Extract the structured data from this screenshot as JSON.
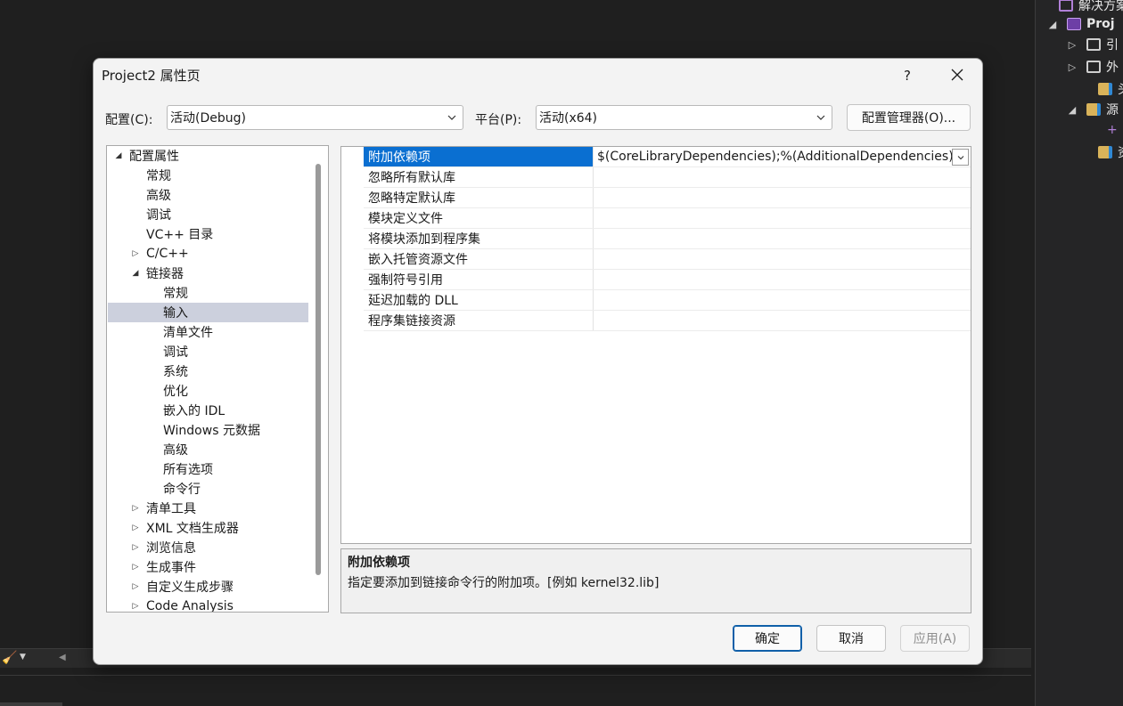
{
  "dialog": {
    "title": "Project2 属性页",
    "help_label": "?",
    "config_label": "配置(C):",
    "config_value": "活动(Debug)",
    "platform_label": "平台(P):",
    "platform_value": "活动(x64)",
    "config_manager_label": "配置管理器(O)...",
    "ok_label": "确定",
    "cancel_label": "取消",
    "apply_label": "应用(A)"
  },
  "tree": {
    "items": [
      {
        "label": "配置属性",
        "level": 0,
        "state": "expanded"
      },
      {
        "label": "常规",
        "level": 1,
        "state": "leaf"
      },
      {
        "label": "高级",
        "level": 1,
        "state": "leaf"
      },
      {
        "label": "调试",
        "level": 1,
        "state": "leaf"
      },
      {
        "label": "VC++ 目录",
        "level": 1,
        "state": "leaf"
      },
      {
        "label": "C/C++",
        "level": 1,
        "state": "collapsed"
      },
      {
        "label": "链接器",
        "level": 1,
        "state": "expanded"
      },
      {
        "label": "常规",
        "level": 2,
        "state": "leaf"
      },
      {
        "label": "输入",
        "level": 2,
        "state": "leaf",
        "selected": true
      },
      {
        "label": "清单文件",
        "level": 2,
        "state": "leaf"
      },
      {
        "label": "调试",
        "level": 2,
        "state": "leaf"
      },
      {
        "label": "系统",
        "level": 2,
        "state": "leaf"
      },
      {
        "label": "优化",
        "level": 2,
        "state": "leaf"
      },
      {
        "label": "嵌入的 IDL",
        "level": 2,
        "state": "leaf"
      },
      {
        "label": "Windows 元数据",
        "level": 2,
        "state": "leaf"
      },
      {
        "label": "高级",
        "level": 2,
        "state": "leaf"
      },
      {
        "label": "所有选项",
        "level": 2,
        "state": "leaf"
      },
      {
        "label": "命令行",
        "level": 2,
        "state": "leaf"
      },
      {
        "label": "清单工具",
        "level": 1,
        "state": "collapsed"
      },
      {
        "label": "XML 文档生成器",
        "level": 1,
        "state": "collapsed"
      },
      {
        "label": "浏览信息",
        "level": 1,
        "state": "collapsed"
      },
      {
        "label": "生成事件",
        "level": 1,
        "state": "collapsed"
      },
      {
        "label": "自定义生成步骤",
        "level": 1,
        "state": "collapsed"
      },
      {
        "label": "Code Analysis",
        "level": 1,
        "state": "collapsed"
      }
    ]
  },
  "grid": {
    "rows": [
      {
        "name": "附加依赖项",
        "value": "$(CoreLibraryDependencies);%(AdditionalDependencies)",
        "selected": true
      },
      {
        "name": "忽略所有默认库",
        "value": ""
      },
      {
        "name": "忽略特定默认库",
        "value": ""
      },
      {
        "name": "模块定义文件",
        "value": ""
      },
      {
        "name": "将模块添加到程序集",
        "value": ""
      },
      {
        "name": "嵌入托管资源文件",
        "value": ""
      },
      {
        "name": "强制符号引用",
        "value": ""
      },
      {
        "name": "延迟加载的 DLL",
        "value": ""
      },
      {
        "name": "程序集链接资源",
        "value": ""
      }
    ]
  },
  "description": {
    "title": "附加依赖项",
    "text": "指定要添加到链接命令行的附加项。[例如 kernel32.lib]"
  },
  "solution_explorer": {
    "items": [
      {
        "label": "解决方案",
        "arrow": "",
        "icon": "solution-icon"
      },
      {
        "label": "Proj",
        "arrow": "◢",
        "icon": "project-icon",
        "bold": true
      },
      {
        "label": "引",
        "arrow": "▷",
        "icon": "references-icon"
      },
      {
        "label": "外",
        "arrow": "▷",
        "icon": "external-deps-icon"
      },
      {
        "label": "头",
        "arrow": "",
        "icon": "folder-filter-icon"
      },
      {
        "label": "源",
        "arrow": "◢",
        "icon": "folder-filter-icon"
      },
      {
        "label": "+",
        "arrow": "",
        "icon": ""
      },
      {
        "label": "资",
        "arrow": "",
        "icon": "folder-filter-icon"
      }
    ]
  },
  "colors": {
    "accent": "#0a6fd1",
    "tree_selected": "#ccd0dd",
    "ide_background": "#1f1f1f"
  }
}
